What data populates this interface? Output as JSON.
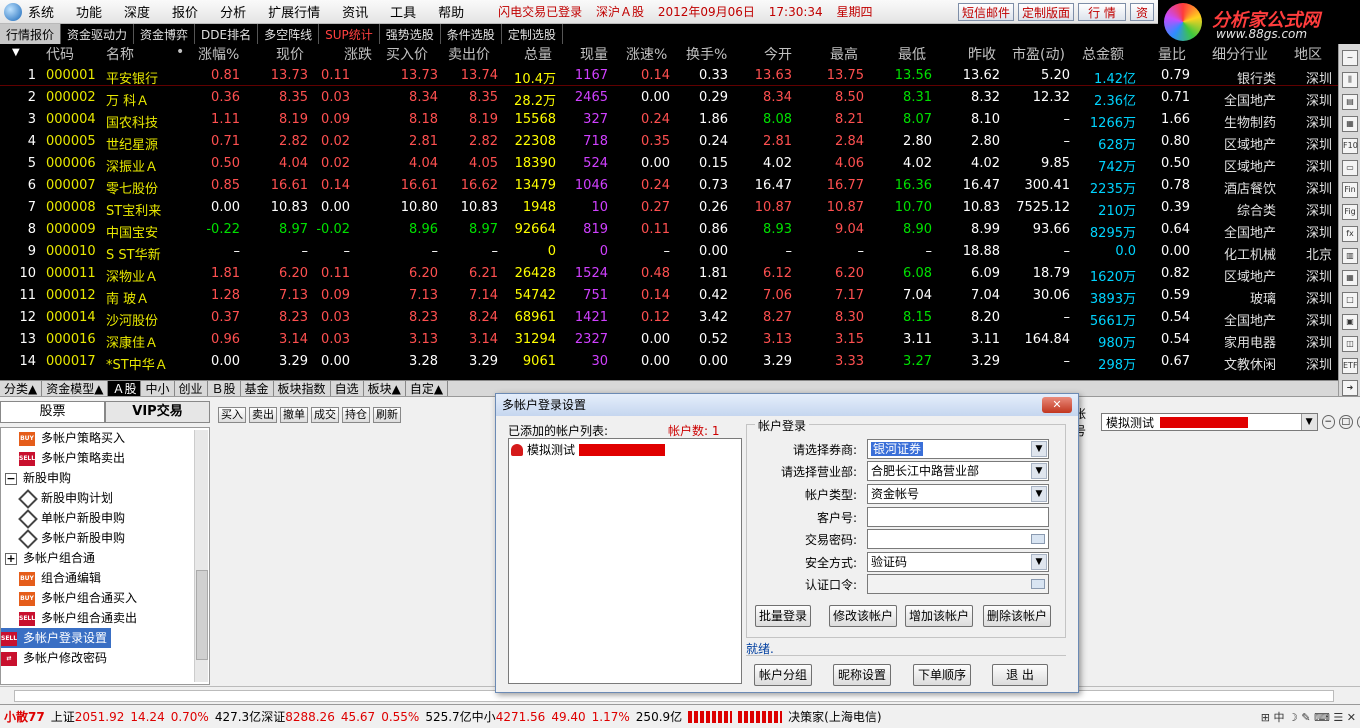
{
  "menu": {
    "items": [
      "系统",
      "功能",
      "深度",
      "报价",
      "分析",
      "扩展行情",
      "资讯",
      "工具",
      "帮助"
    ],
    "status": [
      "闪电交易已登录",
      "深沪Ａ股",
      "2012年09月06日",
      "17:30:34",
      "星期四"
    ],
    "buttons": [
      "短信邮件",
      "定制版面",
      "行 情",
      "资"
    ]
  },
  "brand": {
    "name": "分析家公式网",
    "url": "www.88gs.com"
  },
  "tabs": [
    "行情报价",
    "资金驱动力",
    "资金博弈",
    "DDE排名",
    "多空阵线",
    "SUP统计",
    "强势选股",
    "条件选股",
    "定制选股"
  ],
  "grid": {
    "headers": [
      "代码",
      "名称",
      "•",
      "涨幅%",
      "现价",
      "涨跌",
      "买入价",
      "卖出价",
      "总量",
      "现量",
      "涨速%",
      "换手%",
      "今开",
      "最高",
      "最低",
      "昨收",
      "市盈(动)",
      "总金额",
      "量比",
      "细分行业",
      "地区"
    ],
    "rows": [
      [
        "1",
        "000001",
        "平安银行",
        "0.81",
        "13.73",
        "0.11",
        "13.73",
        "13.74",
        "10.4万",
        "1167",
        "0.14",
        "0.33",
        "13.63",
        "13.75",
        "13.56",
        "13.62",
        "5.20",
        "1.42亿",
        "0.79",
        "银行类",
        "深圳"
      ],
      [
        "2",
        "000002",
        "万 科Ａ",
        "0.36",
        "8.35",
        "0.03",
        "8.34",
        "8.35",
        "28.2万",
        "2465",
        "0.00",
        "0.29",
        "8.34",
        "8.50",
        "8.31",
        "8.32",
        "12.32",
        "2.36亿",
        "0.71",
        "全国地产",
        "深圳"
      ],
      [
        "3",
        "000004",
        "国农科技",
        "1.11",
        "8.19",
        "0.09",
        "8.18",
        "8.19",
        "15568",
        "327",
        "0.24",
        "1.86",
        "8.08",
        "8.21",
        "8.07",
        "8.10",
        "–",
        "1266万",
        "1.66",
        "生物制药",
        "深圳"
      ],
      [
        "4",
        "000005",
        "世纪星源",
        "0.71",
        "2.82",
        "0.02",
        "2.81",
        "2.82",
        "22308",
        "718",
        "0.35",
        "0.24",
        "2.81",
        "2.84",
        "2.80",
        "2.80",
        "–",
        "628万",
        "0.80",
        "区域地产",
        "深圳"
      ],
      [
        "5",
        "000006",
        "深振业Ａ",
        "0.50",
        "4.04",
        "0.02",
        "4.04",
        "4.05",
        "18390",
        "524",
        "0.00",
        "0.15",
        "4.02",
        "4.06",
        "4.02",
        "4.02",
        "9.85",
        "742万",
        "0.50",
        "区域地产",
        "深圳"
      ],
      [
        "6",
        "000007",
        "零七股份",
        "0.85",
        "16.61",
        "0.14",
        "16.61",
        "16.62",
        "13479",
        "1046",
        "0.24",
        "0.73",
        "16.47",
        "16.77",
        "16.36",
        "16.47",
        "300.41",
        "2235万",
        "0.78",
        "酒店餐饮",
        "深圳"
      ],
      [
        "7",
        "000008",
        "ST宝利来",
        "0.00",
        "10.83",
        "0.00",
        "10.80",
        "10.83",
        "1948",
        "10",
        "0.27",
        "0.26",
        "10.87",
        "10.87",
        "10.70",
        "10.83",
        "7525.12",
        "210万",
        "0.39",
        "综合类",
        "深圳"
      ],
      [
        "8",
        "000009",
        "中国宝安",
        "-0.22",
        "8.97",
        "-0.02",
        "8.96",
        "8.97",
        "92664",
        "819",
        "0.11",
        "0.86",
        "8.93",
        "9.04",
        "8.90",
        "8.99",
        "93.66",
        "8295万",
        "0.64",
        "全国地产",
        "深圳"
      ],
      [
        "9",
        "000010",
        "S ST华新",
        "–",
        "–",
        "–",
        "–",
        "–",
        "0",
        "0",
        "–",
        "0.00",
        "–",
        "–",
        "–",
        "18.88",
        "–",
        "0.0",
        "0.00",
        "化工机械",
        "北京"
      ],
      [
        "10",
        "000011",
        "深物业Ａ",
        "1.81",
        "6.20",
        "0.11",
        "6.20",
        "6.21",
        "26428",
        "1524",
        "0.48",
        "1.81",
        "6.12",
        "6.20",
        "6.08",
        "6.09",
        "18.79",
        "1620万",
        "0.82",
        "区域地产",
        "深圳"
      ],
      [
        "11",
        "000012",
        "南 玻Ａ",
        "1.28",
        "7.13",
        "0.09",
        "7.13",
        "7.14",
        "54742",
        "751",
        "0.14",
        "0.42",
        "7.06",
        "7.17",
        "7.04",
        "7.04",
        "30.06",
        "3893万",
        "0.59",
        "玻璃",
        "深圳"
      ],
      [
        "12",
        "000014",
        "沙河股份",
        "0.37",
        "8.23",
        "0.03",
        "8.23",
        "8.24",
        "68961",
        "1421",
        "0.12",
        "3.42",
        "8.27",
        "8.30",
        "8.15",
        "8.20",
        "–",
        "5661万",
        "0.54",
        "全国地产",
        "深圳"
      ],
      [
        "13",
        "000016",
        "深康佳Ａ",
        "0.96",
        "3.14",
        "0.03",
        "3.13",
        "3.14",
        "31294",
        "2327",
        "0.00",
        "0.52",
        "3.13",
        "3.15",
        "3.11",
        "3.11",
        "164.84",
        "980万",
        "0.54",
        "家用电器",
        "深圳"
      ],
      [
        "14",
        "000017",
        "*ST中华Ａ",
        "0.00",
        "3.29",
        "0.00",
        "3.28",
        "3.29",
        "9061",
        "30",
        "0.00",
        "0.00",
        "3.29",
        "3.33",
        "3.27",
        "3.29",
        "–",
        "298万",
        "0.67",
        "文教休闲",
        "深圳"
      ]
    ]
  },
  "colors": {
    "up": "#ff5050",
    "down": "#00e000",
    "flat": "#ffffff",
    "code": "#e8e800",
    "name": "#e8e800",
    "amount": "#00d4ff",
    "vol": "#ffff00",
    "curvol": "#d040ff"
  },
  "bottom_tabs": [
    "分类▲",
    "资金模型▲",
    "Ａ股",
    "中小",
    "创业",
    "Ｂ股",
    "基金",
    "板块指数",
    "自选",
    "板块▲",
    "自定▲"
  ],
  "lower": {
    "tabs": [
      "股票",
      "VIP交易"
    ],
    "tree": [
      {
        "label": "多帐户策略买入",
        "icon": "buy-icon"
      },
      {
        "label": "多帐户策略卖出",
        "icon": "sell-icon"
      },
      {
        "label": "新股申购",
        "icon": "collapse-icon"
      },
      {
        "label": "新股申购计划",
        "icon": "diamond-icon"
      },
      {
        "label": "单帐户新股申购",
        "icon": "diamond-icon"
      },
      {
        "label": "多帐户新股申购",
        "icon": "diamond-icon"
      },
      {
        "label": "多帐户组合通",
        "icon": "expand-icon"
      },
      {
        "label": "组合通编辑",
        "icon": "buy-icon"
      },
      {
        "label": "多帐户组合通买入",
        "icon": "buy-icon"
      },
      {
        "label": "多帐户组合通卖出",
        "icon": "sell-icon"
      },
      {
        "label": "多帐户登录设置",
        "icon": "sell-icon"
      },
      {
        "label": "多帐户修改密码",
        "icon": "swap-icon"
      }
    ],
    "toolbar": [
      "买入",
      "卖出",
      "撤单",
      "成交",
      "持仓",
      "刷新"
    ],
    "account_label": "帐号",
    "account_value": "模拟测试"
  },
  "dialog": {
    "title": "多帐户登录设置",
    "list_label": "已添加的帐户列表:",
    "count_label": "帐户数: 1",
    "list_item": "模拟测试",
    "section": "帐户登录",
    "fields": [
      {
        "label": "请选择券商:",
        "value": "银河证券"
      },
      {
        "label": "请选择营业部:",
        "value": "合肥长江中路营业部"
      },
      {
        "label": "帐户类型:",
        "value": "资金帐号"
      },
      {
        "label": "客户号:",
        "value": ""
      },
      {
        "label": "交易密码:",
        "value": ""
      },
      {
        "label": "安全方式:",
        "value": "验证码"
      },
      {
        "label": "认证口令:",
        "value": ""
      }
    ],
    "actions": [
      "批量登录",
      "修改该帐户",
      "增加该帐户",
      "删除该帐户"
    ],
    "status": "就绪.",
    "footer": [
      "帐户分组",
      "昵称设置",
      "下单顺序",
      "退 出"
    ]
  },
  "statusbar": {
    "sms": "小散77",
    "sh_label": "上证",
    "sh_index": "2051.92",
    "sh_change": "14.24",
    "sh_pct": "0.70%",
    "sh_amount": "427.3亿",
    "sz_label": "深证",
    "sz_index": "8288.26",
    "sz_change": "45.67",
    "sz_pct": "0.55%",
    "sz_amount": "525.7亿",
    "zx_label": "中小",
    "zx_index": "4271.56",
    "zx_change": "49.40",
    "zx_pct": "1.17%",
    "zx_amount": "250.9亿",
    "broker": "决策家(上海电信)"
  }
}
